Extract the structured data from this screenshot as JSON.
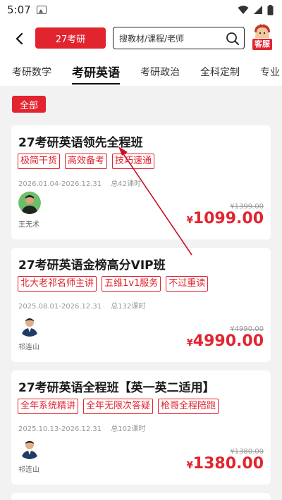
{
  "status": {
    "time": "5:07"
  },
  "header": {
    "pill_label": "27考研",
    "search_placeholder": "搜教材/课程/老师",
    "service_label": "客服"
  },
  "tabs": [
    {
      "label": "考研数学",
      "active": false
    },
    {
      "label": "考研英语",
      "active": true
    },
    {
      "label": "考研政治",
      "active": false
    },
    {
      "label": "全科定制",
      "active": false
    },
    {
      "label": "专业",
      "active": false
    }
  ],
  "filter": {
    "all_label": "全部"
  },
  "courses": [
    {
      "title": "27考研英语领先全程班",
      "tags": [
        "极简干货",
        "高效备考",
        "技巧速通"
      ],
      "date_range": "2026.01.04-2026.12.31",
      "lessons": "总42课时",
      "teacher": "王无术",
      "old_price": "¥1399.00",
      "price_symbol": "¥",
      "price": "1099.00"
    },
    {
      "title": "27考研英语金榜高分VIP班",
      "tags": [
        "北大老祁名师主讲",
        "五维1v1服务",
        "不过重读"
      ],
      "date_range": "2025.08.01-2026.12.31",
      "lessons": "总132课时",
      "teacher": "祁连山",
      "old_price": "¥4990.00",
      "price_symbol": "¥",
      "price": "4990.00"
    },
    {
      "title": "27考研英语全程班【英一英二适用】",
      "tags": [
        "全年系统精讲",
        "全年无限次答疑",
        "枪哥全程陪跑"
      ],
      "date_range": "2025.10.13-2026.12.31",
      "lessons": "总102课时",
      "teacher": "祁连山",
      "old_price": "¥1380.00",
      "price_symbol": "¥",
      "price": "1380.00"
    }
  ],
  "colors": {
    "accent": "#e2242f",
    "background": "#f2f2f2"
  },
  "icons": [
    "image-icon",
    "wifi-icon",
    "signal-icon",
    "battery-icon",
    "back-arrow-icon",
    "search-icon",
    "customer-service-icon"
  ]
}
